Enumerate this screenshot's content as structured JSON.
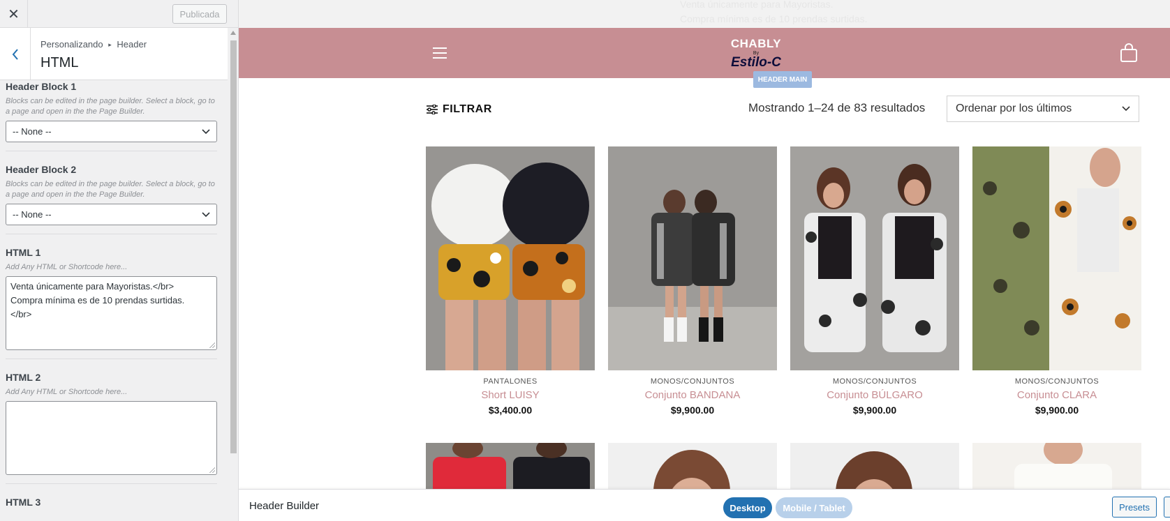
{
  "sidebar": {
    "close_label": "✕",
    "publish_label": "Publicada",
    "breadcrumb": {
      "root": "Personalizando",
      "separator": "▸",
      "section": "Header"
    },
    "section_title": "HTML",
    "controls": [
      {
        "label": "Header Block 1",
        "description": "Blocks can be edited in the page builder. Select a block, go to a page and open in the the Page Builder.",
        "value": "-- None --"
      },
      {
        "label": "Header Block 2",
        "description": "Blocks can be edited in the page builder. Select a block, go to a page and open in the the Page Builder.",
        "value": "-- None --"
      },
      {
        "label": "HTML 1",
        "placeholder": "Add Any HTML or Shortcode here...",
        "value": "Venta únicamente para Mayoristas.</br>\nCompra mínima es de 10 prendas surtidas.\n</br>"
      },
      {
        "label": "HTML 2",
        "placeholder": "Add Any HTML or Shortcode here...",
        "value": ""
      },
      {
        "label": "HTML 3"
      }
    ]
  },
  "preview": {
    "topbar_lines": [
      "Venta únicamente para Mayoristas.",
      "Compra mínima es de 10 prendas surtidas."
    ],
    "logo": {
      "line1": "CHABLY",
      "line2": "By",
      "line3": "Estilo-C"
    },
    "header_badge": "HEADER MAIN",
    "filter_label": "FILTRAR",
    "results": "Mostrando 1–24 de 83 resultados",
    "orderby": "Ordenar por los últimos",
    "products": [
      {
        "category": "PANTALONES",
        "name": "Short LUISY",
        "price": "$3,400.00"
      },
      {
        "category": "MONOS/CONJUNTOS",
        "name": "Conjunto BANDANA",
        "price": "$9,900.00"
      },
      {
        "category": "MONOS/CONJUNTOS",
        "name": "Conjunto BÚLGARO",
        "price": "$9,900.00"
      },
      {
        "category": "MONOS/CONJUNTOS",
        "name": "Conjunto CLARA",
        "price": "$9,900.00"
      }
    ]
  },
  "builder": {
    "title": "Header Builder",
    "desktop_label": "Desktop",
    "mobile_label": "Mobile / Tablet",
    "presets_label": "Presets"
  },
  "colors": {
    "header_bg": "#c78e93",
    "accent_blue": "#2271b1",
    "product_name": "#c78e93"
  }
}
